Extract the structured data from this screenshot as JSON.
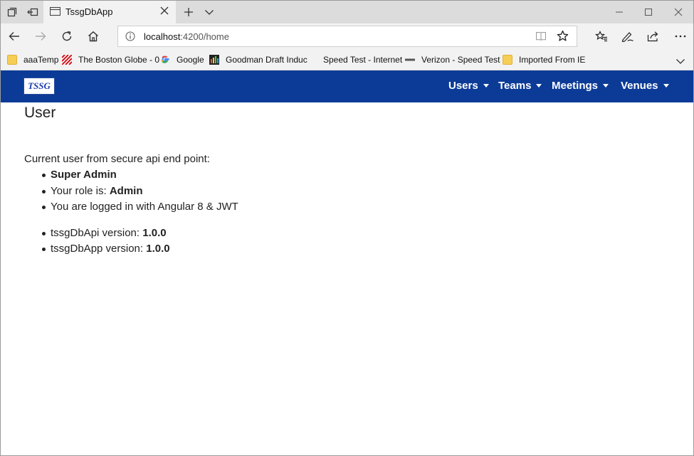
{
  "browser": {
    "tab_title": "TssgDbApp",
    "url_host": "localhost",
    "url_rest": ":4200/home",
    "favorites": [
      {
        "label": "aaaTemp",
        "icon": "folder-icon"
      },
      {
        "label": "The Boston Globe - 0",
        "icon": "boston-globe-favicon"
      },
      {
        "label": "Google",
        "icon": "google-favicon"
      },
      {
        "label": "Goodman Draft Induc",
        "icon": "goodman-favicon"
      },
      {
        "label": "Speed Test - Internet",
        "icon": "none"
      },
      {
        "label": "Verizon - Speed Test",
        "icon": "verizon-favicon"
      },
      {
        "label": "Imported From IE",
        "icon": "folder-icon"
      }
    ]
  },
  "app": {
    "logo_text": "TSSG",
    "nav": [
      {
        "label": "Users"
      },
      {
        "label": "Teams"
      },
      {
        "label": "Meetings"
      },
      {
        "label": "Venues"
      }
    ],
    "accent_color": "#0c3b97"
  },
  "page": {
    "title": "User",
    "intro": "Current user from secure api end point:",
    "user_name": "Super Admin",
    "role_prefix": "Your role is: ",
    "role": "Admin",
    "login_note": "You are logged in with Angular 8 & JWT",
    "api_prefix": "tssgDbApi version: ",
    "api_version": "1.0.0",
    "app_prefix": "tssgDbApp version: ",
    "app_version": "1.0.0"
  }
}
